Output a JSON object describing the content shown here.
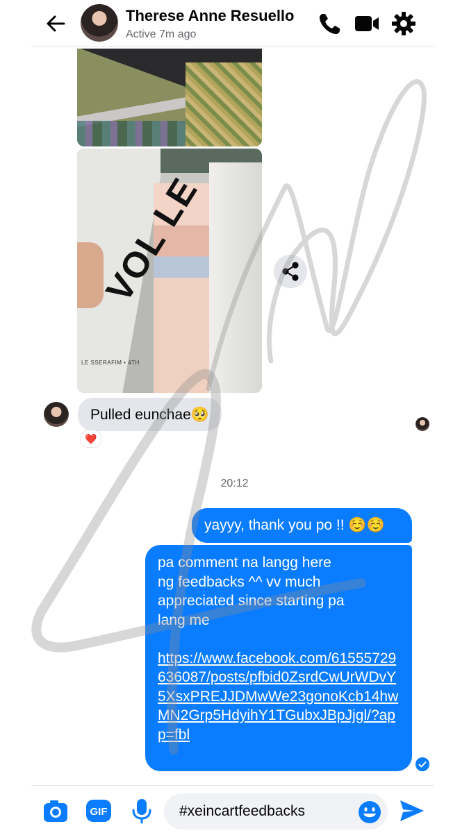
{
  "header": {
    "contact_name": "Therese Anne Resuello",
    "status": "Active 7m ago",
    "icons": [
      "back-arrow-icon",
      "phone-icon",
      "video-icon",
      "gear-icon"
    ]
  },
  "messages": {
    "photo_caption": "LE SSERAFIM • 4TH",
    "photo_title": "VOL LE",
    "incoming_text": "Pulled eunchae🥺",
    "reaction": "❤️",
    "timestamp": "20:12",
    "outgoing_1": "yayyy, thank you po !! ☺️☺️",
    "outgoing_2_text": "pa comment na langg here\nng feedbacks ^^ vv much\nappreciated since starting pa\nlang me",
    "outgoing_2_link": "https://www.facebook.com/61555729636087/posts/pfbid0ZsrdCwUrWDvY5XsxPREJJDMwWe23gonoKcb14hwMN2Grp5HdyihY1TGubxJBpJjgl/?app=fbl"
  },
  "composer": {
    "input_value": "#xeincartfeedbacks",
    "gif_label": "GIF"
  },
  "colors": {
    "accent": "#0a7cff",
    "incoming_bubble": "#e4e6eb",
    "muted_text": "#65676b"
  }
}
